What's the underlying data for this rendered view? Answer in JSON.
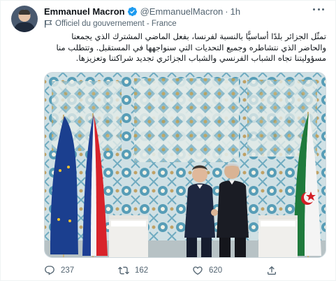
{
  "tweet": {
    "author_name": "Emmanuel Macron",
    "handle": "@EmmanuelMacron",
    "separator": "·",
    "time": "1h",
    "account_label": "Officiel du gouvernement - France",
    "text": "تمثّل الجزائر بلدًا أساسيًّا بالنسبة لفرنسا، بفعل الماضي المشترك الذي يجمعنا والحاضر الذي نتشاطره وجميع التحديات التي سنواجهها في المستقبل. وتتطلب منا مسؤوليتنا تجاه الشباب الفرنسي والشباب الجزائري تجديد شراكتنا وتعزيزها."
  },
  "actions": {
    "replies": "237",
    "retweets": "162",
    "likes": "620"
  },
  "icons": {
    "verified": "verified-badge-icon",
    "more": "more-icon",
    "account_label": "government-flag-icon",
    "reply": "reply-icon",
    "retweet": "retweet-icon",
    "like": "heart-icon",
    "share": "share-icon"
  },
  "colors": {
    "verified_blue": "#1d9bf0",
    "secondary_text": "#536471",
    "primary_text": "#0f1419"
  }
}
